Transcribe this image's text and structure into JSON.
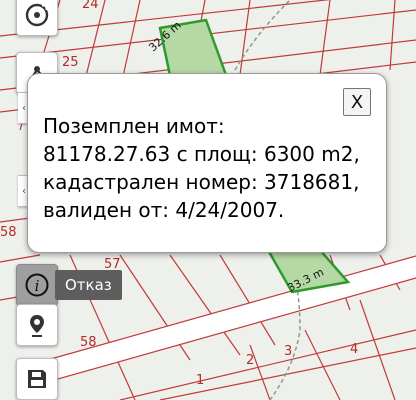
{
  "map": {
    "parcel_numbers": {
      "n24": "24",
      "n25": "25",
      "n58a": "58",
      "n57": "57",
      "n58b": "58",
      "n2": "2",
      "n3": "3",
      "n4": "4",
      "n1": "1"
    },
    "measurements": {
      "top": "32.6 m",
      "bottom": "33.3 m"
    },
    "colors": {
      "background": "#eef0ec",
      "parcel_border": "#c23a3a",
      "highlight_fill": "#b5d9a4",
      "highlight_border": "#2e9a2e",
      "road": "#ffffff"
    }
  },
  "toolbar": {
    "buttons": {
      "compass": "compass-icon",
      "measure": "measure-icon",
      "info": "info-icon",
      "location": "location-pin-icon",
      "save": "save-icon"
    },
    "tooltip": "Отказ",
    "side_tab_glyph": "‹"
  },
  "popup": {
    "close_label": "X",
    "lines": [
      "Поземплен имот:",
      "81178.27.63 с площ: 6300 m2,",
      "кадастрален номер: 3718681,",
      "валиден от: 4/24/2007."
    ]
  }
}
